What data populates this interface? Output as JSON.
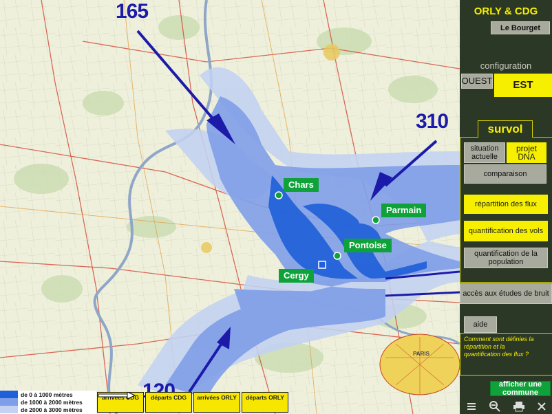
{
  "map": {
    "flows": [
      "165",
      "310",
      "120"
    ],
    "towns": [
      "Chars",
      "Parmain",
      "Pontoise",
      "Cergy"
    ],
    "city_label": "PARIS"
  },
  "legend": {
    "bands": [
      {
        "label": "de 0 à 1000 mètres",
        "color": "#1f5fd9"
      },
      {
        "label": "de 1000 à 2000 mètres",
        "color": "#7f9ee8"
      },
      {
        "label": "de 2000 à 3000 mètres",
        "color": "#c3d2f2"
      }
    ],
    "keys": [
      {
        "label": "arrivées CDG",
        "style": "blue-fill"
      },
      {
        "label": "départs CDG",
        "style": "blue-outline"
      },
      {
        "label": "arrivées ORLY",
        "style": "black-fill"
      },
      {
        "label": "départs ORLY",
        "style": "black-outline"
      }
    ]
  },
  "panel": {
    "title": "ORLY & CDG",
    "le_bourget": "Le Bourget",
    "configuration_label": "configuration",
    "config_ouest": "OUEST",
    "config_est": "EST",
    "config_selected": "EST",
    "survol_tab": "survol",
    "situation_actuelle": "situation actuelle",
    "projet_dna": "projet DNA",
    "comparaison": "comparaison",
    "repartition_flux": "répartition des flux",
    "quantification_vols": "quantification des vols",
    "quantification_population": "quantification de la population",
    "acces_etudes": "accès aux études de bruit",
    "aide": "aide",
    "help_question": "Comment sont définies la répartition et la quantification des flux ?",
    "afficher_commune": "afficher une commune",
    "accent_yellow": "#f6f000",
    "panel_bg": "#2c3826",
    "active_green": "#10a23a"
  },
  "toolbar": {
    "icons": [
      "list-icon",
      "zoom-out-icon",
      "print-icon",
      "close-icon"
    ]
  }
}
